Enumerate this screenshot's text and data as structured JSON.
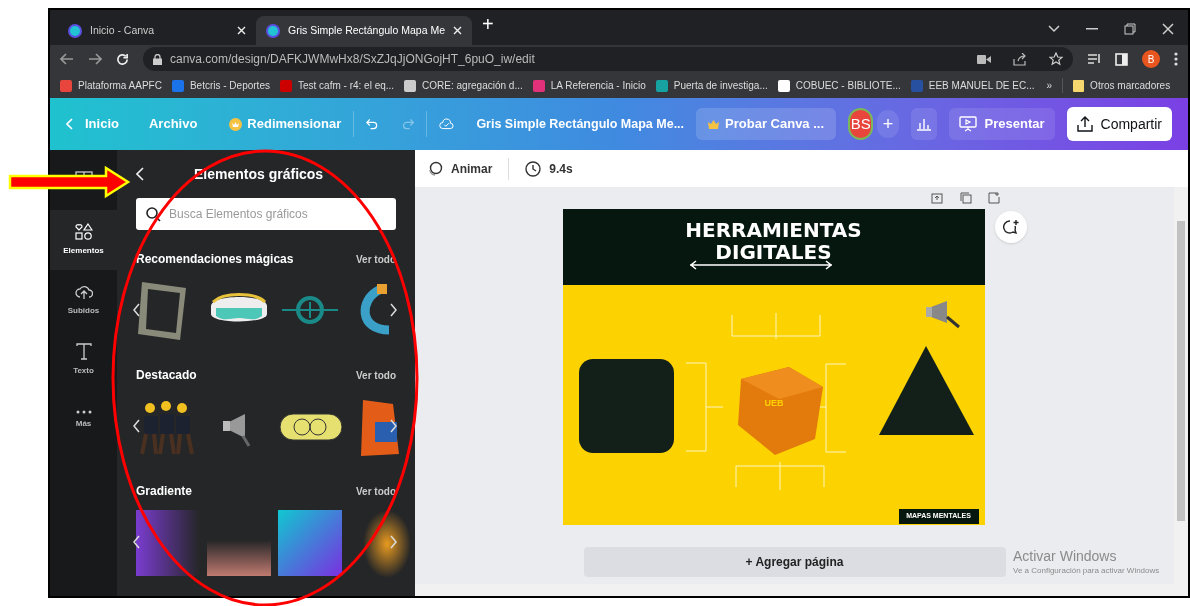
{
  "browser": {
    "tabs": [
      {
        "title": "Inicio - Canva",
        "selected": false
      },
      {
        "title": "Gris Simple Rectángulo Mapa Me",
        "selected": true
      }
    ],
    "new_tab": "+",
    "url": "canva.com/design/DAFKJWMwHx8/SxZJqJjONGojHT_6puO_iw/edit",
    "profile_initial": "B",
    "bookmarks": [
      "Plataforma AAPFC",
      "Betcris - Deportes",
      "Test cafm - r4: el eq...",
      "CORE: agregación d...",
      "LA Referencia - Inicio",
      "Puerta de investiga...",
      "COBUEC - BIBLIOTE...",
      "EEB MANUEL DE EC..."
    ],
    "more_bookmarks": "»",
    "other_bookmarks": "Otros marcadores"
  },
  "toolbar": {
    "home": "Inicio",
    "file": "Archivo",
    "resize": "Redimensionar",
    "title": "Gris Simple Rectángulo Mapa Me...",
    "trial": "Probar Canva ...",
    "avatar": "BS",
    "add": "+",
    "present": "Presentar",
    "share": "Compartir"
  },
  "rail": [
    {
      "selected": false
    },
    {
      "label": "Elementos",
      "selected": true
    },
    {
      "label": "Subidos",
      "selected": false
    },
    {
      "label": "Texto",
      "selected": false
    },
    {
      "label": "Más",
      "selected": false
    }
  ],
  "panel": {
    "title": "Elementos gráficos",
    "search_placeholder": "Busca Elementos gráficos",
    "sections": [
      {
        "title": "Recomendaciones mágicas",
        "link": "Ver todo"
      },
      {
        "title": "Destacado",
        "link": "Ver todo"
      },
      {
        "title": "Gradiente",
        "link": "Ver todo"
      }
    ]
  },
  "editor": {
    "animate": "Animar",
    "duration": "9.4s",
    "design": {
      "title_lines": [
        "HERRAMIENTAS",
        "DIGITALES"
      ],
      "cube_label": "UEB",
      "footer_tag": "MAPAS MENTALES"
    },
    "add_page": "+ Agregar página"
  },
  "os_notice": {
    "title": "Activar Windows",
    "subtitle": "Ve a Configuración para activar Windows"
  }
}
